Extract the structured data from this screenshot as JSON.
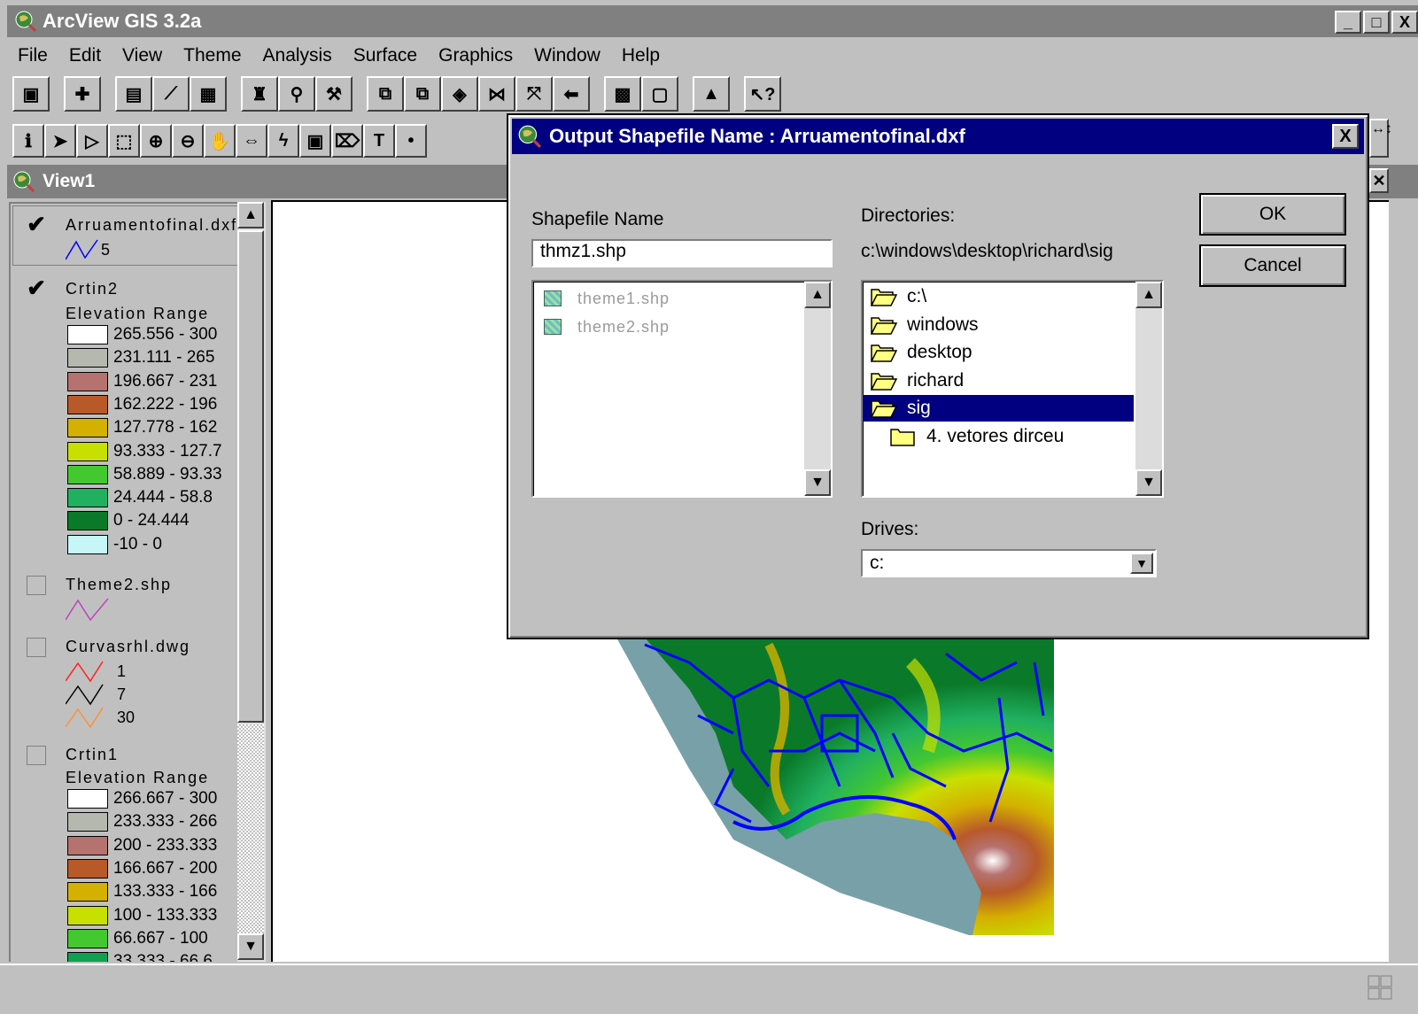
{
  "app": {
    "title": "ArcView GIS 3.2a",
    "window_buttons": [
      "_",
      "□",
      "X"
    ]
  },
  "menu": [
    "File",
    "Edit",
    "View",
    "Theme",
    "Analysis",
    "Surface",
    "Graphics",
    "Window",
    "Help"
  ],
  "toolbar1_icons": [
    "save-icon",
    "add-theme-icon",
    "theme-properties-icon",
    "edit-legend-icon",
    "open-table-icon",
    "find-icon",
    "locate-address-icon",
    "query-builder-icon",
    "zoom-full-extent-icon",
    "zoom-active-themes-icon",
    "zoom-selected-icon",
    "zoom-in-icon",
    "zoom-out-icon",
    "zoom-previous-icon",
    "select-by-theme-icon",
    "clear-selection-icon",
    "create-chart-icon",
    "help-icon"
  ],
  "toolbar2_icons": [
    "identify-icon",
    "pointer-icon",
    "vertex-edit-icon",
    "select-feature-icon",
    "zoom-in-tool-icon",
    "zoom-out-tool-icon",
    "pan-icon",
    "measure-icon",
    "hotlink-icon",
    "area-of-interest-icon",
    "label-icon",
    "text-icon",
    "draw-point-icon"
  ],
  "view": {
    "title": "View1"
  },
  "toc": {
    "themes": [
      {
        "name": "Arruamentofinal.dxf",
        "checked": true,
        "legend_label": "5",
        "line_color": "#0000ff"
      },
      {
        "name": "Crtin2",
        "checked": true,
        "subtitle": "Elevation Range",
        "classes": [
          {
            "label": "265.556 - 300",
            "color": "#ffffff"
          },
          {
            "label": "231.111 - 265",
            "color": "#b5b8ae"
          },
          {
            "label": "196.667 - 231",
            "color": "#b5726f"
          },
          {
            "label": "162.222 - 196",
            "color": "#b8592a"
          },
          {
            "label": "127.778 - 162",
            "color": "#d4b000"
          },
          {
            "label": "93.333 - 127.7",
            "color": "#c8e000"
          },
          {
            "label": "58.889 - 93.33",
            "color": "#44c830"
          },
          {
            "label": "24.444 - 58.8",
            "color": "#20b060"
          },
          {
            "label": "0 - 24.444",
            "color": "#0a7a2a"
          },
          {
            "label": "-10 - 0",
            "color": "#c6f6f8"
          }
        ]
      },
      {
        "name": "Theme2.shp",
        "checked": false,
        "line_color": "#c040c0"
      },
      {
        "name": "Curvasrhl.dwg",
        "checked": false,
        "lines": [
          {
            "label": "1",
            "color": "#ff2020"
          },
          {
            "label": "7",
            "color": "#000000"
          },
          {
            "label": "30",
            "color": "#ff9030"
          }
        ]
      },
      {
        "name": "Crtin1",
        "checked": false,
        "subtitle": "Elevation Range",
        "classes": [
          {
            "label": "266.667 - 300",
            "color": "#ffffff"
          },
          {
            "label": "233.333 - 266",
            "color": "#b5b8ae"
          },
          {
            "label": "200 - 233.333",
            "color": "#b5726f"
          },
          {
            "label": "166.667 - 200",
            "color": "#b8592a"
          },
          {
            "label": "133.333 - 166",
            "color": "#d4b000"
          },
          {
            "label": "100 - 133.333",
            "color": "#c8e000"
          },
          {
            "label": "66.667 - 100",
            "color": "#44c830"
          },
          {
            "label": "33.333 - 66.6",
            "color": "#10a050"
          }
        ]
      }
    ]
  },
  "dialog": {
    "title": "Output Shapefile Name : Arruamentofinal.dxf",
    "shapefile_label": "Shapefile Name",
    "shapefile_value": "thmz1.shp",
    "files": [
      "theme1.shp",
      "theme2.shp"
    ],
    "directories_label": "Directories:",
    "current_path": "c:\\windows\\desktop\\richard\\sig",
    "directories": [
      {
        "label": "c:\\",
        "open": true,
        "selected": false,
        "indent": 0
      },
      {
        "label": "windows",
        "open": true,
        "selected": false,
        "indent": 0
      },
      {
        "label": "desktop",
        "open": true,
        "selected": false,
        "indent": 0
      },
      {
        "label": "richard",
        "open": true,
        "selected": false,
        "indent": 0
      },
      {
        "label": "sig",
        "open": true,
        "selected": true,
        "indent": 0
      },
      {
        "label": "4. vetores dirceu",
        "open": false,
        "selected": false,
        "indent": 1
      }
    ],
    "drives_label": "Drives:",
    "drive_value": "c:",
    "ok_label": "OK",
    "cancel_label": "Cancel",
    "close_label": "X"
  },
  "colors": {
    "titlebar_active": "#000080",
    "titlebar_inactive": "#808080",
    "face": "#c0c0c0",
    "road_blue": "#0000ff",
    "water": "#78a0a8"
  }
}
